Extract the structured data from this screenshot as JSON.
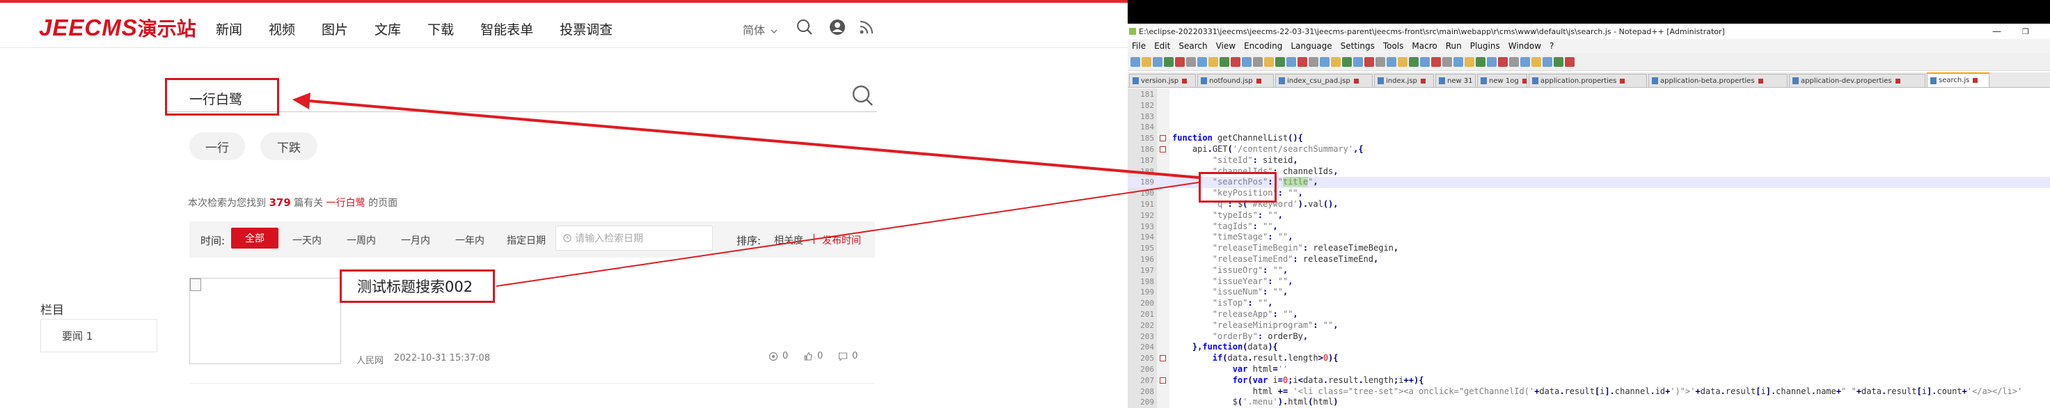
{
  "site": {
    "logo": {
      "latin": "JEECMS",
      "cn": "演示站"
    },
    "nav": [
      "新闻",
      "视频",
      "图片",
      "文库",
      "下载",
      "智能表单",
      "投票调查"
    ],
    "lang": "简体",
    "search_query": "一行白鹭",
    "tags": [
      "一行",
      "下跌"
    ],
    "result_info": {
      "prefix": "本次检索为您找到",
      "count": "379",
      "middle": "篇有关",
      "keyword": "一行白鹭",
      "suffix": "的页面"
    },
    "filter": {
      "time_label": "时间:",
      "time_options": [
        "全部",
        "一天内",
        "一周内",
        "一月内",
        "一年内",
        "指定日期"
      ],
      "date_placeholder": "请输入检索日期",
      "sort_label": "排序:",
      "sort_options": [
        "相关度",
        "发布时间"
      ],
      "sort_separator": "|"
    },
    "column": {
      "title": "栏目",
      "items": [
        "要闻 1"
      ]
    },
    "result": {
      "title": "测试标题搜索002",
      "source": "人民网",
      "date": "2022-10-31 15:37:08",
      "views": "0",
      "likes": "0",
      "comments": "0"
    },
    "colors": {
      "brand": "#d7111f",
      "annotation": "#d9151e"
    }
  },
  "editor": {
    "title": "E:\\eclipse-20220331\\jeecms\\jeecms-22-03-31\\jeecms-parent\\jeecms-front\\src\\main\\webapp\\r\\cms\\www\\default\\js\\search.js - Notepad++ [Administrator]",
    "menu": [
      "File",
      "Edit",
      "Search",
      "View",
      "Encoding",
      "Language",
      "Settings",
      "Tools",
      "Macro",
      "Run",
      "Plugins",
      "Window",
      "?"
    ],
    "tabs": [
      "version.jsp",
      "notfound.jsp",
      "index_csu_pad.jsp",
      "index.jsp",
      "new 31",
      "new 1og",
      "application.properties",
      "application-beta.properties",
      "application-dev.properties",
      "search.js"
    ],
    "active_tab": "search.js",
    "lines": [
      {
        "n": "181",
        "t": ""
      },
      {
        "n": "182",
        "t": ""
      },
      {
        "n": "183",
        "t": ""
      },
      {
        "n": "184",
        "t": ""
      },
      {
        "n": "185",
        "t": "function getChannelList(){",
        "fold": true
      },
      {
        "n": "186",
        "t": "    api.GET('/content/searchSummary',{",
        "fold": true
      },
      {
        "n": "187",
        "t": "        \"siteId\": siteid,"
      },
      {
        "n": "188",
        "t": "        \"channelIds\": channelIds,"
      },
      {
        "n": "189",
        "t": "        \"searchPos\": \"title\",",
        "cur": true
      },
      {
        "n": "190",
        "t": "        \"keyPosition\": \"\","
      },
      {
        "n": "191",
        "t": "        \"q\": $('#keyword').val(),"
      },
      {
        "n": "192",
        "t": "        \"typeIds\": \"\","
      },
      {
        "n": "193",
        "t": "        \"tagIds\": \"\","
      },
      {
        "n": "194",
        "t": "        \"timeStage\": \"\","
      },
      {
        "n": "195",
        "t": "        \"releaseTimeBegin\": releaseTimeBegin,"
      },
      {
        "n": "196",
        "t": "        \"releaseTimeEnd\": releaseTimeEnd,"
      },
      {
        "n": "197",
        "t": "        \"issueOrg\": \"\","
      },
      {
        "n": "198",
        "t": "        \"issueYear\": \"\","
      },
      {
        "n": "199",
        "t": "        \"issueNum\": \"\","
      },
      {
        "n": "200",
        "t": "        \"isTop\": \"\","
      },
      {
        "n": "201",
        "t": "        \"releaseApp\": \"\","
      },
      {
        "n": "202",
        "t": "        \"releaseMiniprogram\": \"\","
      },
      {
        "n": "203",
        "t": "        \"orderBy\": orderBy,"
      },
      {
        "n": "204",
        "t": "    },function(data){"
      },
      {
        "n": "205",
        "t": "        if(data.result.length>0){",
        "fold": true
      },
      {
        "n": "206",
        "t": "            var html=''"
      },
      {
        "n": "207",
        "t": "            for(var i=0;i<data.result.length;i++){",
        "fold": true
      },
      {
        "n": "208",
        "t": "                html += '<li class=\"tree-set\"><a onclick=\"getChannelId('+data.result[i].channel.id+')\">'+data.result[i].channel.name+\" \"+data.result[i].count+'</a></li>'"
      },
      {
        "n": "209",
        "t": "            $('.menu').html(html)"
      }
    ]
  }
}
